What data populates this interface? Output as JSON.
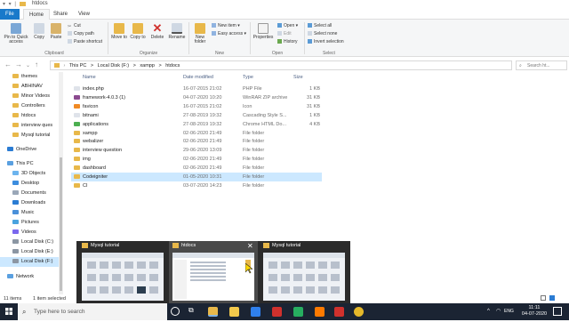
{
  "window": {
    "title": "htdocs",
    "quick_access": "▾ ▾ |"
  },
  "ribbon": {
    "tabs": [
      "File",
      "Home",
      "Share",
      "View"
    ],
    "clipboard": {
      "pin": "Pin to Quick access",
      "copy": "Copy",
      "paste": "Paste",
      "cut": "Cut",
      "copy_path": "Copy path",
      "paste_shortcut": "Paste shortcut",
      "group": "Clipboard"
    },
    "organize": {
      "move_to": "Move to",
      "copy_to": "Copy to",
      "delete": "Delete",
      "rename": "Rename",
      "group": "Organize"
    },
    "new": {
      "new_folder": "New folder",
      "new_item": "New item",
      "easy_access": "Easy access",
      "group": "New"
    },
    "open": {
      "properties": "Properties",
      "open": "Open",
      "edit": "Edit",
      "history": "History",
      "group": "Open"
    },
    "select": {
      "select_all": "Select all",
      "select_none": "Select none",
      "invert": "Invert selection",
      "group": "Select"
    }
  },
  "address": {
    "crumbs": [
      "This PC",
      ">",
      "Local Disk (F:)",
      ">",
      "xampp",
      ">",
      "htdocs"
    ],
    "search_placeholder": "Search ht..."
  },
  "nav": {
    "items": [
      {
        "label": "themes",
        "icon": "folder-icon"
      },
      {
        "label": "ABHINAV",
        "icon": "folder-icon"
      },
      {
        "label": "Minor Videos",
        "icon": "folder-icon"
      },
      {
        "label": "Controllers",
        "icon": "folder-icon"
      },
      {
        "label": "htdocs",
        "icon": "folder-icon"
      },
      {
        "label": "interview ques",
        "icon": "folder-icon"
      },
      {
        "label": "Mysql tutorial",
        "icon": "folder-icon"
      },
      {
        "label": "OneDrive",
        "icon": "cloud-icon"
      },
      {
        "label": "This PC",
        "icon": "computer-icon"
      },
      {
        "label": "3D Objects",
        "icon": "cube-icon"
      },
      {
        "label": "Desktop",
        "icon": "desktop-icon"
      },
      {
        "label": "Documents",
        "icon": "documents-icon"
      },
      {
        "label": "Downloads",
        "icon": "download-icon"
      },
      {
        "label": "Music",
        "icon": "music-icon"
      },
      {
        "label": "Pictures",
        "icon": "pictures-icon"
      },
      {
        "label": "Videos",
        "icon": "videos-icon"
      },
      {
        "label": "Local Disk (C:)",
        "icon": "drive-icon"
      },
      {
        "label": "Local Disk (E:)",
        "icon": "drive-icon"
      },
      {
        "label": "Local Disk (F:)",
        "icon": "drive-icon"
      },
      {
        "label": "Network",
        "icon": "network-icon"
      }
    ]
  },
  "columns": {
    "name": "Name",
    "date": "Date modified",
    "type": "Type",
    "size": "Size"
  },
  "files": [
    {
      "name": "index.php",
      "date": "16-07-2015 21:02",
      "type": "PHP File",
      "size": "1 KB",
      "color": "#dfe3ea"
    },
    {
      "name": "framework-4.0.3 (1)",
      "date": "04-07-2020 10:20",
      "type": "WinRAR ZIP archive",
      "size": "31 KB",
      "color": "#8b4a8f"
    },
    {
      "name": "favicon",
      "date": "16-07-2015 21:02",
      "type": "Icon",
      "size": "31 KB",
      "color": "#f08a24"
    },
    {
      "name": "bitnami",
      "date": "27-08-2019 19:32",
      "type": "Cascading Style S...",
      "size": "1 KB",
      "color": "#dfe3ea"
    },
    {
      "name": "applications",
      "date": "27-08-2019 19:32",
      "type": "Chrome HTML Do...",
      "size": "4 KB",
      "color": "#4caf50"
    },
    {
      "name": "xampp",
      "date": "02-06-2020 21:49",
      "type": "File folder",
      "size": "",
      "color": "#e8b84a"
    },
    {
      "name": "webalizer",
      "date": "02-06-2020 21:49",
      "type": "File folder",
      "size": "",
      "color": "#e8b84a"
    },
    {
      "name": "interview question",
      "date": "29-06-2020 13:09",
      "type": "File folder",
      "size": "",
      "color": "#e8b84a"
    },
    {
      "name": "img",
      "date": "02-06-2020 21:49",
      "type": "File folder",
      "size": "",
      "color": "#e8b84a"
    },
    {
      "name": "dashboard",
      "date": "02-06-2020 21:49",
      "type": "File folder",
      "size": "",
      "color": "#e8b84a"
    },
    {
      "name": "Codeigniter",
      "date": "01-05-2020 10:31",
      "type": "File folder",
      "size": "",
      "color": "#e8b84a"
    },
    {
      "name": "CI",
      "date": "03-07-2020 14:23",
      "type": "File folder",
      "size": "",
      "color": "#e8b84a"
    }
  ],
  "status": {
    "items": "11 items",
    "selected": "1 item selected"
  },
  "thumbnails": [
    {
      "title": "Mysql tutorial"
    },
    {
      "title": "htdocs"
    },
    {
      "title": "Mysql tutorial"
    }
  ],
  "taskbar": {
    "search_placeholder": "Type here to search",
    "time": "11:11",
    "date": "04-07-2020",
    "lang": "ENG"
  },
  "colors": {
    "accent": "#1979ca",
    "selection": "#cce8ff",
    "folder": "#e8b84a",
    "taskbar": "#1b2433"
  }
}
